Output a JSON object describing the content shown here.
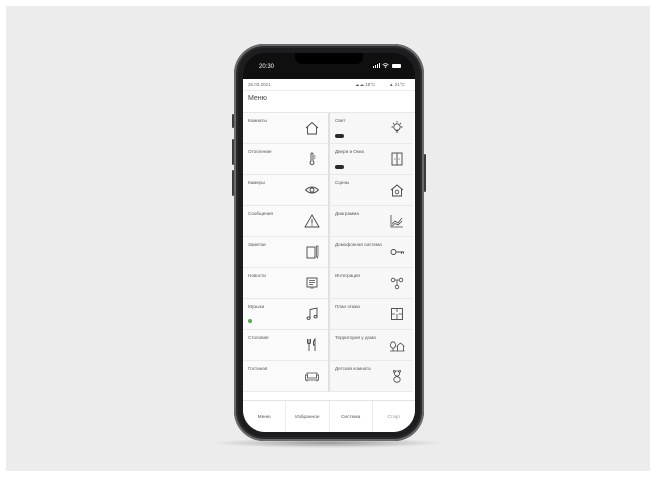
{
  "status": {
    "time": "20:30"
  },
  "infobar": {
    "date": "26.03.2021",
    "weather1": "☁☁ 18°C",
    "weather2": "▲ 21°C"
  },
  "menu": {
    "title": "Меню"
  },
  "tiles": [
    {
      "label": "Комнаты",
      "icon": "home-icon"
    },
    {
      "label": "Свет",
      "icon": "lightbulb-icon"
    },
    {
      "label": "Отопление",
      "icon": "thermometer-icon"
    },
    {
      "label": "Двери и Окна",
      "icon": "window-icon"
    },
    {
      "label": "Камеры",
      "icon": "eye-icon"
    },
    {
      "label": "Сцены",
      "icon": "house-scene-icon"
    },
    {
      "label": "Сообщения",
      "icon": "warning-icon"
    },
    {
      "label": "Диаграмма",
      "icon": "chart-icon"
    },
    {
      "label": "Заметки",
      "icon": "notes-icon"
    },
    {
      "label": "Домофонная система",
      "icon": "key-icon"
    },
    {
      "label": "Новости",
      "icon": "news-icon"
    },
    {
      "label": "Интеграция",
      "icon": "integration-icon"
    },
    {
      "label": "Музыка",
      "icon": "music-icon"
    },
    {
      "label": "План этажа",
      "icon": "floorplan-icon"
    },
    {
      "label": "Столовая",
      "icon": "cutlery-icon"
    },
    {
      "label": "Территория у дома",
      "icon": "house-tree-icon"
    },
    {
      "label": "Гостиная",
      "icon": "sofa-icon"
    },
    {
      "label": "Детская комната",
      "icon": "teddy-icon"
    }
  ],
  "tabs": [
    "Меню",
    "Избранное",
    "Система",
    "Старт"
  ],
  "colors": {
    "accent_dot": "#4caf50",
    "badge": "#2b2b2b"
  }
}
